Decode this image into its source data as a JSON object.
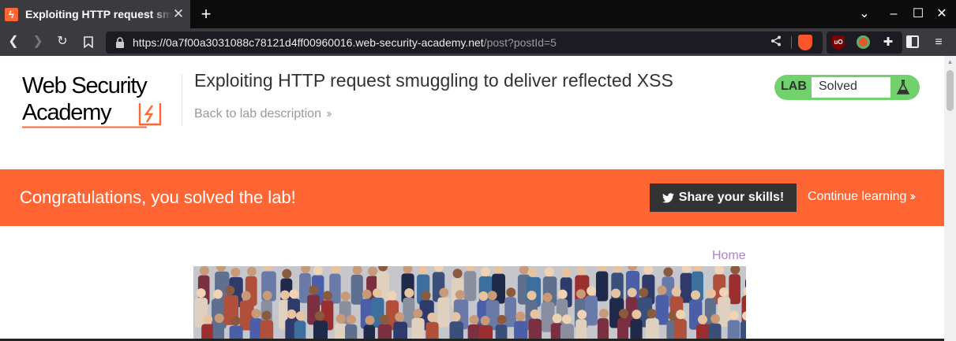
{
  "browser": {
    "tab": {
      "title": "Exploiting HTTP request smuggling to deliver reflected XSS",
      "favicon": "lightning-icon"
    },
    "url": {
      "main": "https://0a7f00a3031088c78121d4ff00960016.web-security-academy.net",
      "path": "/post?postId=5"
    }
  },
  "header": {
    "logo_line1": "Web Security",
    "logo_line2": "Academy",
    "title": "Exploiting HTTP request smuggling to deliver reflected XSS",
    "back_link": "Back to lab description",
    "lab_badge": "LAB",
    "lab_status": "Solved"
  },
  "banner": {
    "message": "Congratulations, you solved the lab!",
    "share_label": "Share your skills!",
    "continue_label": "Continue learning"
  },
  "nav": {
    "home": "Home"
  },
  "colors": {
    "accent": "#ff6633",
    "lab_green": "#70d16d",
    "link_purple": "#b37ecf",
    "dark_button": "#333333"
  }
}
